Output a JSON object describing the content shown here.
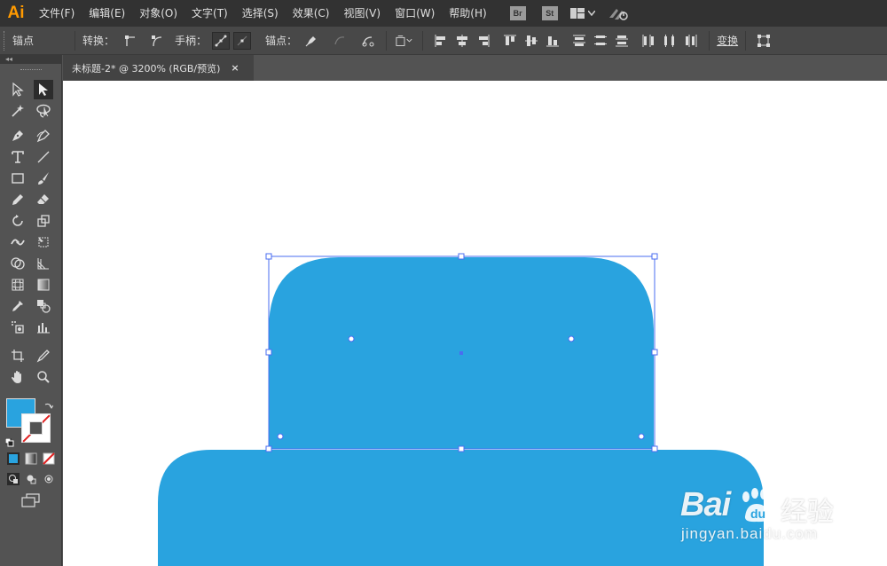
{
  "app": {
    "logo": "Ai"
  },
  "menu": [
    {
      "label": "文件(F)"
    },
    {
      "label": "编辑(E)"
    },
    {
      "label": "对象(O)"
    },
    {
      "label": "文字(T)"
    },
    {
      "label": "选择(S)"
    },
    {
      "label": "效果(C)"
    },
    {
      "label": "视图(V)"
    },
    {
      "label": "窗口(W)"
    },
    {
      "label": "帮助(H)"
    }
  ],
  "menubar_buttons": {
    "bridge": "Br",
    "stock": "St"
  },
  "control_bar": {
    "anchor_label": "锚点",
    "convert_label": "转换：",
    "handles_label": "手柄：",
    "anchors_label": "锚点：",
    "transform_label": "变换"
  },
  "document": {
    "tab_title": "未标题-2* @ 3200% (RGB/预览)",
    "close_glyph": "×"
  },
  "colors": {
    "shape_fill": "#29a3df",
    "selection": "#4a6cf0",
    "fill_swatch": "#29a3df"
  },
  "watermark": {
    "brand": "Bai",
    "brand_cn": "经验",
    "url": "jingyan.baidu.com"
  },
  "toolbox": {
    "collapse_glyph": "◂◂"
  }
}
